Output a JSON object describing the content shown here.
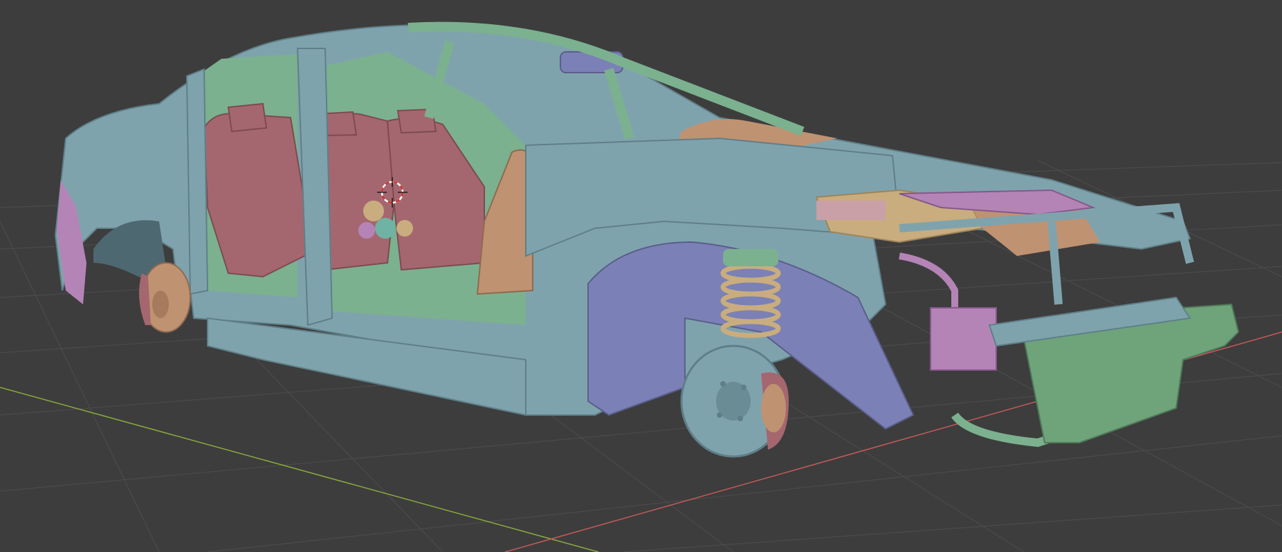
{
  "app": "3D viewport",
  "viewport": {
    "shading": "solid",
    "grid": true,
    "axes": {
      "x_axis_color": "#c85a5a",
      "y_axis_color": "#8aab3c"
    },
    "background_color": "#3d3d3d",
    "grid_color": "#4b4b4b",
    "cursor": "3d-cursor-icon"
  },
  "model": {
    "name": "",
    "palette": {
      "body": "#7fa3ad",
      "interior": "#7bb18f",
      "seats": "#a5676f",
      "wheel_liner": "#7b80b6",
      "brakes": "#bf9272",
      "engine_parts": "#b584b7",
      "engine_block": "#c9ad7e",
      "bumper": "#6fa47b"
    }
  }
}
